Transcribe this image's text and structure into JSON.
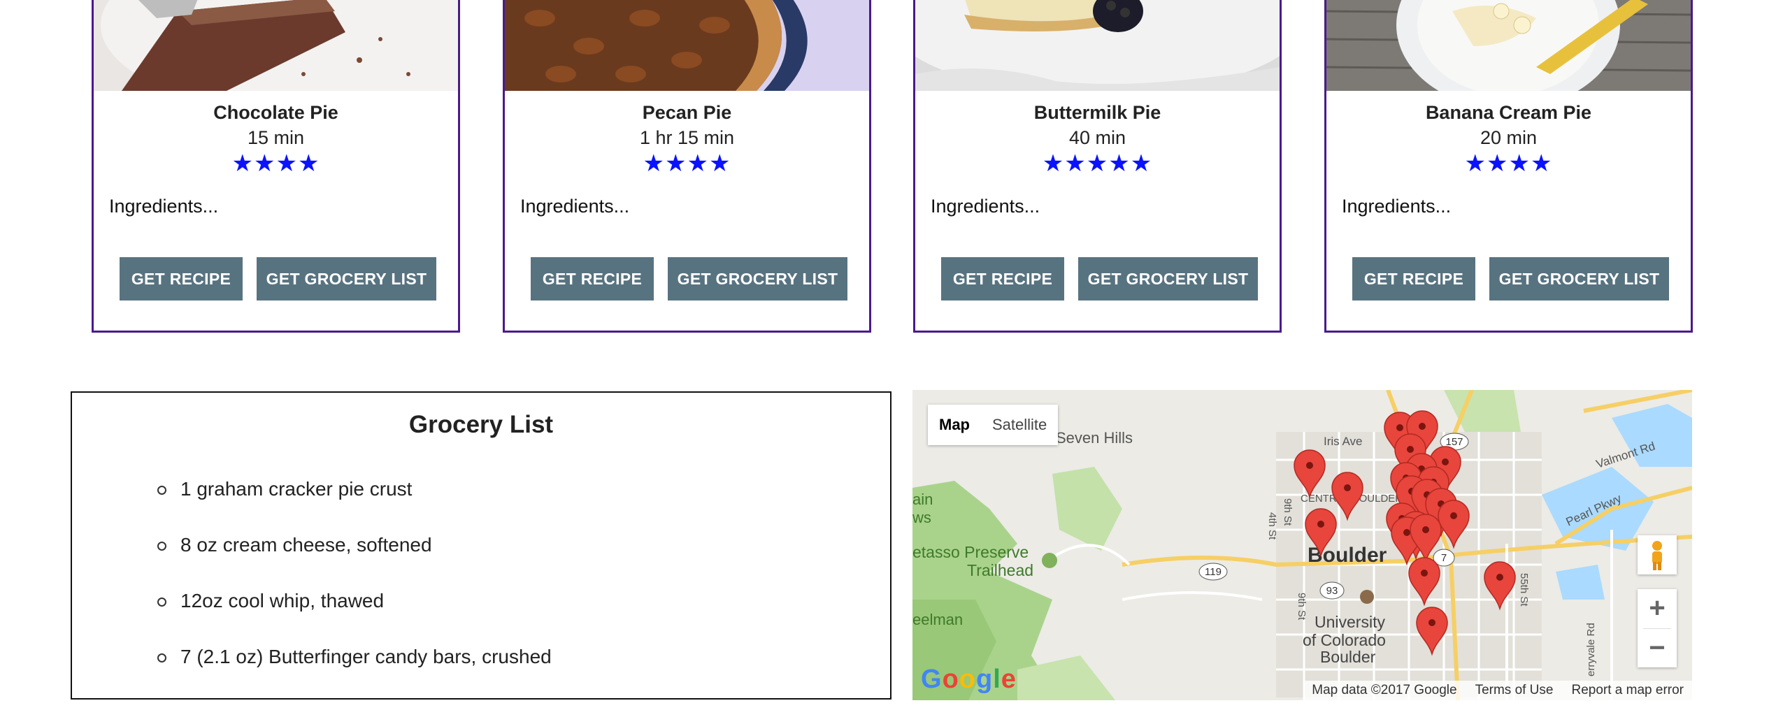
{
  "cards": [
    {
      "title": "Chocolate Pie",
      "time": "15 min",
      "stars": "★★★★",
      "ingredients": "Ingredients...",
      "recipe_btn": "GET RECIPE",
      "grocery_btn": "GET GROCERY LIST"
    },
    {
      "title": "Pecan Pie",
      "time": "1 hr 15 min",
      "stars": "★★★★",
      "ingredients": "Ingredients...",
      "recipe_btn": "GET RECIPE",
      "grocery_btn": "GET GROCERY LIST"
    },
    {
      "title": "Buttermilk Pie",
      "time": "40 min",
      "stars": "★★★★★",
      "ingredients": "Ingredients...",
      "recipe_btn": "GET RECIPE",
      "grocery_btn": "GET GROCERY LIST"
    },
    {
      "title": "Banana Cream Pie",
      "time": "20 min",
      "stars": "★★★★",
      "ingredients": "Ingredients...",
      "recipe_btn": "GET RECIPE",
      "grocery_btn": "GET GROCERY LIST"
    }
  ],
  "grocery": {
    "title": "Grocery List",
    "items": [
      "1 graham cracker pie crust",
      "8 oz cream cheese, softened",
      "12oz cool whip, thawed",
      "7 (2.1 oz) Butterfinger candy bars, crushed"
    ]
  },
  "map": {
    "type_map": "Map",
    "type_satellite": "Satellite",
    "labels": {
      "seven_hills": "Seven Hills",
      "iris_ave": "Iris Ave",
      "central_boulder": "CENTRAL BOULDER",
      "boulder": "Boulder",
      "university": "University",
      "of_colorado": "of Colorado",
      "boulder2": "Boulder",
      "pearl_pkwy": "Pearl Pkwy",
      "valmont_rd": "Valmont Rd",
      "preserve": "etasso Preserve",
      "trailhead": "Trailhead",
      "views": "ain",
      "views2": "ws",
      "eelman": "eelman",
      "st4": "4th St",
      "st9": "9th St",
      "st9b": "9th St",
      "st55": "55th St",
      "cherryvale": "erryvale Rd",
      "r157": "157",
      "r119": "119",
      "r93": "93",
      "r7": "7"
    },
    "zoom_in": "+",
    "zoom_out": "−",
    "footer": {
      "data": "Map data ©2017 Google",
      "terms": "Terms of Use",
      "report": "Report a map error"
    },
    "logo": "Google",
    "pin_color": "#e8453c"
  },
  "colors": {
    "card_border": "#4a1a8c",
    "button": "#587380",
    "stars": "#0a12ff"
  }
}
